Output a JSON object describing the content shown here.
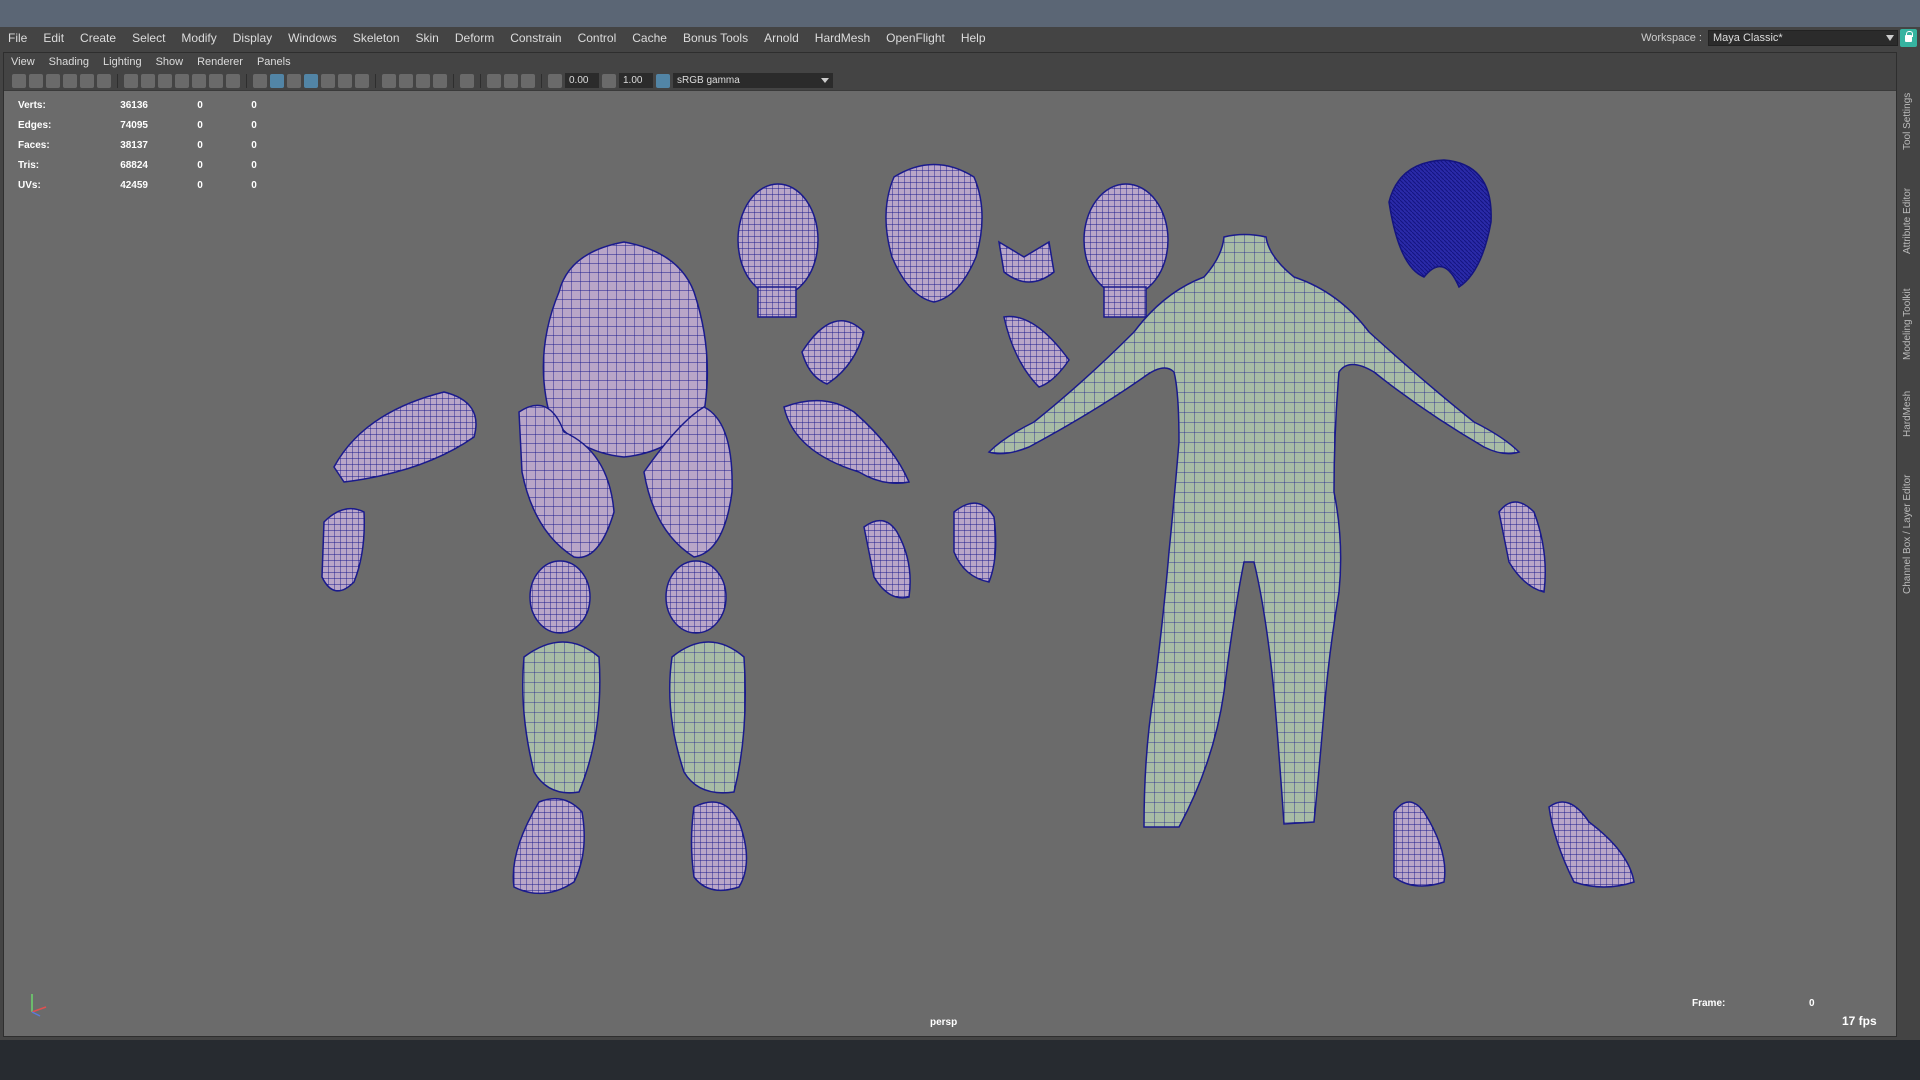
{
  "main_menu": [
    "File",
    "Edit",
    "Create",
    "Select",
    "Modify",
    "Display",
    "Windows",
    "Skeleton",
    "Skin",
    "Deform",
    "Constrain",
    "Control",
    "Cache",
    "Bonus Tools",
    "Arnold",
    "HardMesh",
    "OpenFlight",
    "Help"
  ],
  "workspace": {
    "label": "Workspace :",
    "value": "Maya Classic*"
  },
  "panel_menu": [
    "View",
    "Shading",
    "Lighting",
    "Show",
    "Renderer",
    "Panels"
  ],
  "toolbar": {
    "field_a": "0.00",
    "field_b": "1.00",
    "color_space": "sRGB gamma"
  },
  "hud": {
    "rows": [
      {
        "label": "Verts:",
        "v1": "36136",
        "v2": "0",
        "v3": "0"
      },
      {
        "label": "Edges:",
        "v1": "74095",
        "v2": "0",
        "v3": "0"
      },
      {
        "label": "Faces:",
        "v1": "38137",
        "v2": "0",
        "v3": "0"
      },
      {
        "label": "Tris:",
        "v1": "68824",
        "v2": "0",
        "v3": "0"
      },
      {
        "label": "UVs:",
        "v1": "42459",
        "v2": "0",
        "v3": "0"
      }
    ]
  },
  "camera_label": "persp",
  "frame": {
    "label": "Frame:",
    "value": "0"
  },
  "fps": "17 fps",
  "side_tabs": [
    "Tool Settings",
    "Attribute Editor",
    "Modeling Toolkit",
    "HardMesh",
    "Channel Box / Layer Editor"
  ],
  "colors": {
    "wire": "#1a1a8c",
    "armor_fill": "#b9a6c8",
    "body_fill": "#a8bca5",
    "hair": "#1e1e9a",
    "viewport_bg": "#6b6b6b"
  }
}
